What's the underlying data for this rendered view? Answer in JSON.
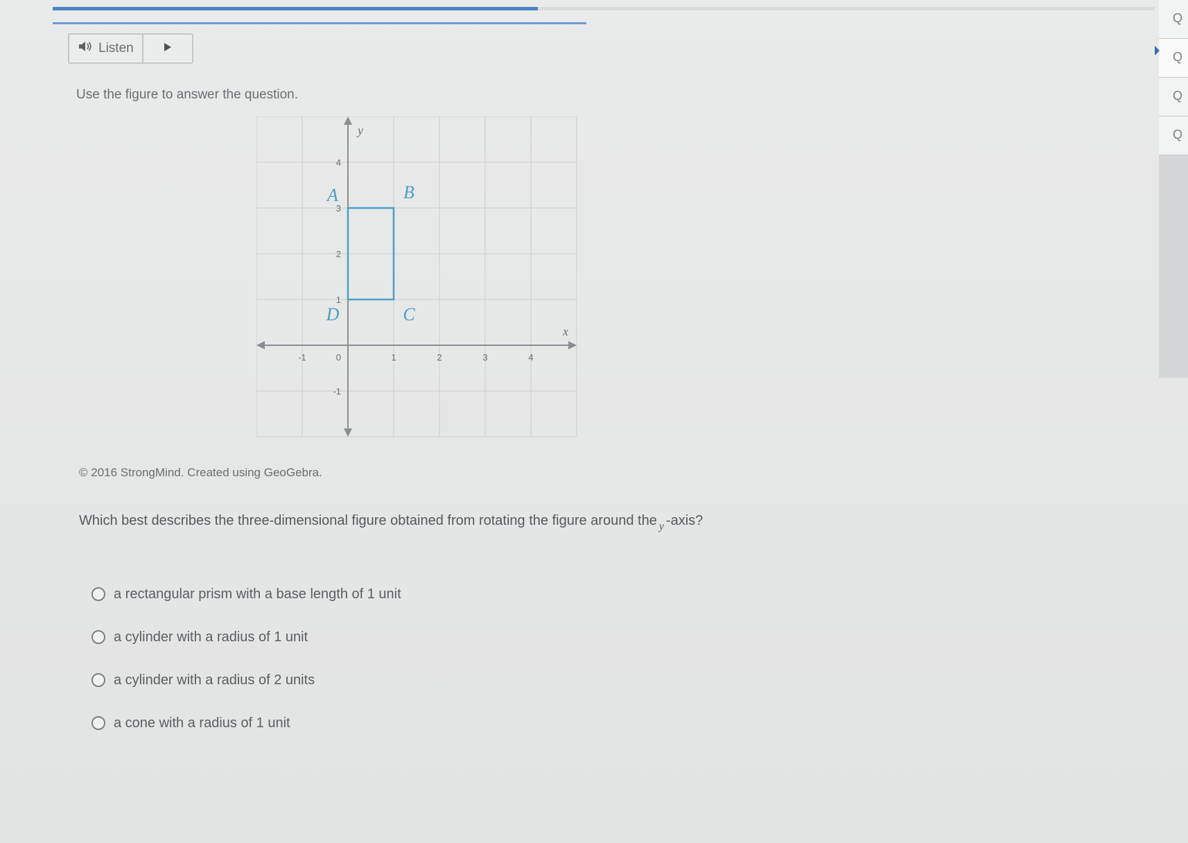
{
  "listen": {
    "label": "Listen",
    "icon": "speaker-icon",
    "play_icon": "play-icon"
  },
  "instruction": "Use the figure to answer the question.",
  "figure": {
    "labels": {
      "A": "A",
      "B": "B",
      "C": "C",
      "D": "D",
      "x_axis": "x",
      "y_axis": "y"
    },
    "x_ticks": [
      "-1",
      "1",
      "2",
      "3",
      "4"
    ],
    "y_ticks": [
      "4",
      "3",
      "2",
      "1",
      "-1"
    ],
    "origin": "0",
    "rectangle": {
      "x_min": 0,
      "x_max": 1,
      "y_min": 1,
      "y_max": 3
    },
    "x_range": [
      -2,
      5
    ],
    "y_range": [
      -2,
      5
    ]
  },
  "credit": "© 2016 StrongMind. Created using GeoGebra.",
  "question": {
    "before": "Which best describes the three-dimensional figure obtained from rotating the figure around the",
    "variable": "y",
    "after": "-axis?"
  },
  "options": [
    "a rectangular prism with a base length of 1 unit",
    "a cylinder with a radius of 1 unit",
    "a cylinder with a radius of 2 units",
    "a cone with a radius of 1 unit"
  ],
  "side_tabs": [
    "Q",
    "Q",
    "Q",
    "Q"
  ],
  "colors": {
    "accent": "#4a84c4",
    "figure_blue": "#4aa0c8"
  },
  "progress": 0.44
}
